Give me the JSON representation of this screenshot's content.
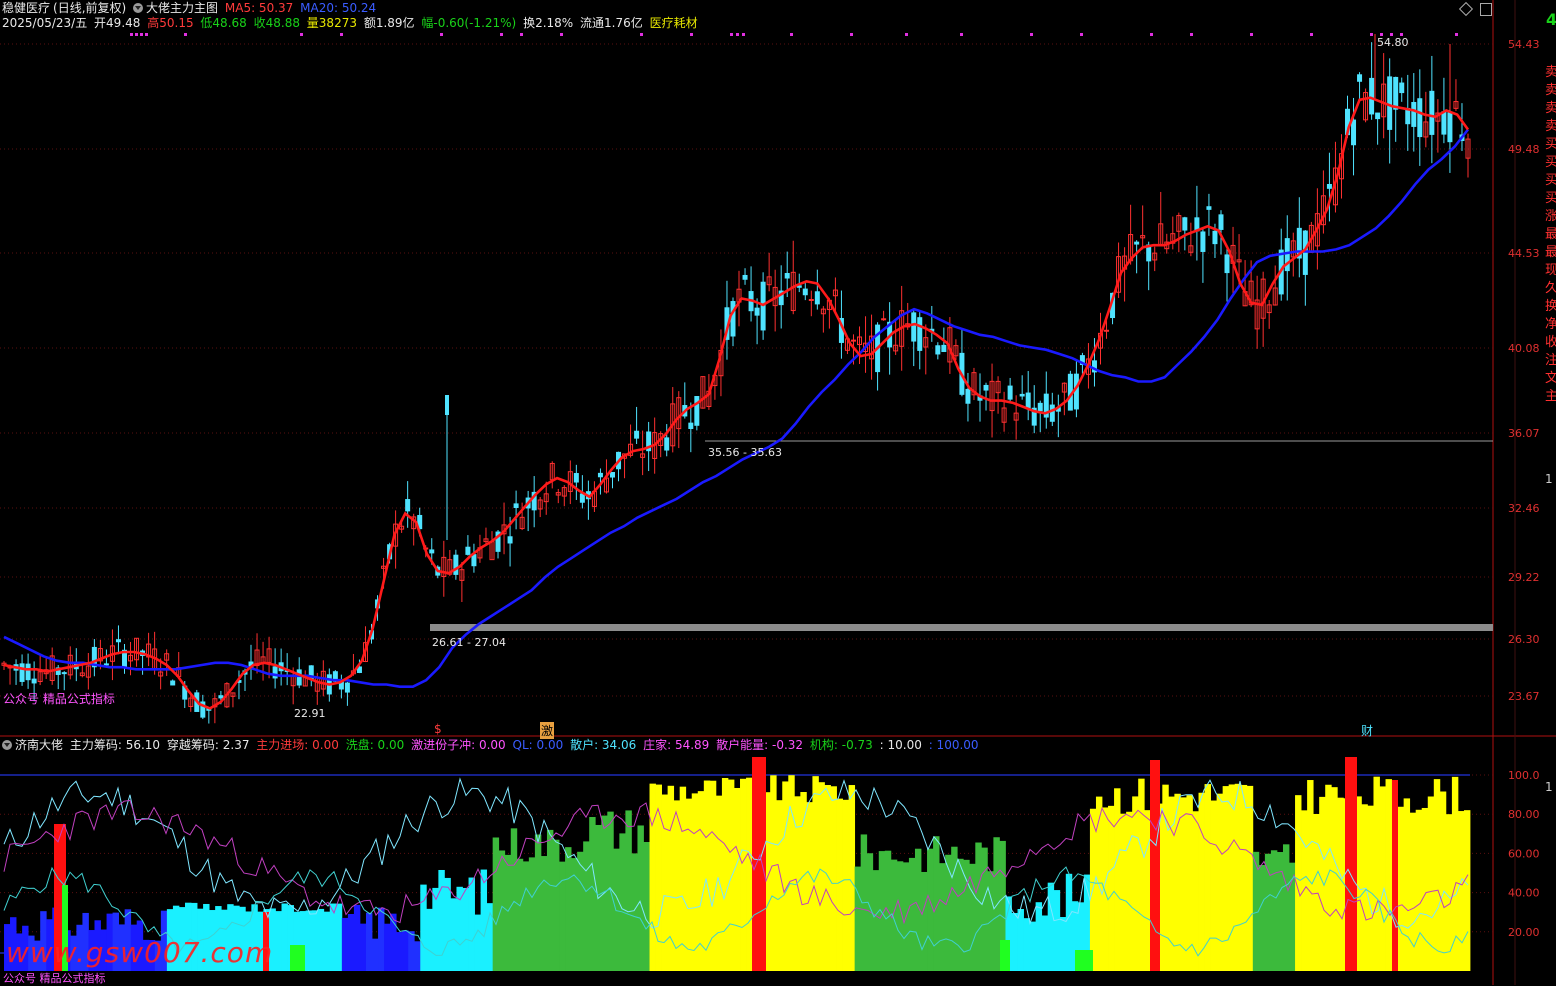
{
  "header": {
    "stock_name": "稳健医疗",
    "period": "(日线,前复权)",
    "indicator_name": "大佬主力主图",
    "ma5": "MA5: 50.37",
    "ma20": "MA20: 50.24",
    "date": "2025/05/23/五",
    "open": "开49.48",
    "high": "高50.15",
    "low": "低48.68",
    "close": "收48.88",
    "volume": "量38273",
    "amount": "额1.89亿",
    "change": "幅-0.60(-1.21%)",
    "turnover": "换2.18%",
    "float": "流通1.76亿",
    "sector": "医疗耗材"
  },
  "main_axis": {
    "labels": [
      "54.43",
      "49.48",
      "44.53",
      "40.08",
      "36.07",
      "32.46",
      "29.22",
      "26.30",
      "23.67"
    ]
  },
  "annotations": {
    "high_mark": "54.80",
    "low_mark": "22.91",
    "zone1": "35.56 - 35.63",
    "zone2": "26.61 - 27.04"
  },
  "signals": {
    "s1": "$",
    "s2": "激",
    "s3": "财"
  },
  "watermark": {
    "main": "公众号 精品公式指标",
    "sub": "公众号 精品公式指标",
    "site": "www.gsw007.com"
  },
  "indicator": {
    "name": "济南大佬",
    "zhuli": "主力筹码: 56.10",
    "chuanyue": "穿越筹码: 2.37",
    "jinchang": "主力进场: 0.00",
    "xipan": "洗盘: 0.00",
    "jijin": "激进份子冲: 0.00",
    "ql": "QL: 0.00",
    "sanhu": "散户: 34.06",
    "zhuangjia": "庄家: 54.89",
    "sanhu_energy": "散户能量: -0.32",
    "jigou": "机构: -0.73",
    "ten": ": 10.00",
    "hundred": ": 100.00"
  },
  "sub_axis": {
    "labels": [
      "100.0",
      "80.00",
      "60.00",
      "40.00",
      "20.00"
    ]
  },
  "right_edge": {
    "badge": "4",
    "chars": [
      "卖",
      "卖",
      "卖",
      "卖",
      "买",
      "买",
      "买",
      "买",
      "涨",
      "最",
      "最",
      "现",
      "久",
      "换",
      "净",
      "收",
      "注",
      "文",
      "主"
    ],
    "mid": "1",
    "sub": "1"
  },
  "colors": {
    "up": "#ff3030",
    "down": "#4fe3ff",
    "ma5": "#ff1a1a",
    "ma20": "#1a1aff"
  },
  "chart_data": {
    "type": "candlestick",
    "axis_labels": [
      54.43,
      49.48,
      44.53,
      40.08,
      36.07,
      32.46,
      29.22,
      26.3,
      23.67
    ],
    "ma5": [
      25.1,
      25.0,
      24.9,
      24.9,
      24.8,
      24.9,
      25.0,
      25.1,
      25.2,
      25.4,
      25.6,
      25.7,
      25.7,
      25.6,
      25.4,
      25.1,
      24.6,
      23.9,
      23.3,
      23.1,
      23.4,
      24.0,
      24.7,
      25.1,
      25.2,
      25.1,
      24.9,
      24.7,
      24.5,
      24.3,
      24.2,
      24.3,
      24.6,
      25.3,
      26.8,
      29.0,
      31.2,
      32.2,
      31.8,
      30.3,
      29.5,
      29.4,
      29.7,
      30.2,
      30.6,
      30.9,
      31.3,
      31.9,
      32.5,
      33.1,
      33.6,
      33.9,
      33.7,
      33.3,
      33.0,
      33.6,
      34.3,
      34.9,
      35.2,
      35.3,
      35.5,
      36.0,
      36.7,
      37.2,
      37.5,
      37.9,
      39.6,
      41.6,
      42.4,
      42.3,
      42.1,
      42.4,
      42.7,
      43.0,
      43.2,
      43.1,
      42.4,
      41.4,
      40.3,
      39.7,
      39.8,
      40.3,
      40.8,
      41.1,
      41.2,
      41.0,
      40.7,
      40.3,
      39.1,
      38.2,
      37.8,
      37.6,
      37.6,
      37.5,
      37.3,
      37.1,
      37.0,
      37.2,
      37.6,
      38.3,
      39.3,
      40.5,
      42.0,
      43.6,
      44.3,
      44.8,
      44.9,
      44.9,
      45.1,
      45.4,
      45.6,
      45.8,
      45.6,
      44.6,
      43.1,
      42.2,
      42.1,
      43.1,
      43.9,
      44.3,
      44.7,
      45.6,
      46.6,
      48.3,
      50.5,
      51.8,
      51.9,
      51.7,
      51.5,
      51.4,
      51.3,
      51.1,
      51.0,
      51.3,
      51.1,
      50.4
    ],
    "ma20": [
      26.4,
      26.1,
      25.8,
      25.5,
      25.3,
      25.2,
      25.2,
      25.1,
      25.0,
      25.0,
      24.9,
      24.9,
      24.9,
      24.9,
      25.0,
      25.1,
      25.2,
      25.2,
      25.1,
      24.9,
      24.7,
      24.6,
      24.6,
      24.6,
      24.5,
      24.4,
      24.4,
      24.3,
      24.2,
      24.2,
      24.1,
      24.1,
      24.4,
      25.0,
      25.9,
      26.5,
      27.0,
      27.4,
      27.8,
      28.2,
      28.6,
      29.2,
      29.7,
      30.1,
      30.5,
      30.9,
      31.3,
      31.6,
      32.0,
      32.3,
      32.6,
      32.9,
      33.3,
      33.7,
      34.0,
      34.4,
      34.8,
      35.1,
      35.4,
      35.8,
      36.5,
      37.3,
      38.0,
      38.6,
      39.3,
      39.9,
      40.6,
      41.1,
      41.6,
      41.9,
      41.7,
      41.4,
      41.1,
      40.9,
      40.7,
      40.6,
      40.4,
      40.2,
      40.1,
      40.0,
      39.8,
      39.6,
      39.3,
      39.0,
      38.8,
      38.7,
      38.5,
      38.5,
      38.7,
      39.3,
      39.9,
      40.6,
      41.4,
      42.4,
      43.3,
      44.1,
      44.4,
      44.5,
      44.6,
      44.6,
      44.6,
      44.7,
      44.9,
      45.3,
      45.7,
      46.3,
      47.0,
      47.8,
      48.5,
      49.0,
      49.6,
      50.4
    ],
    "series_names": [
      "MA5",
      "MA20"
    ]
  }
}
